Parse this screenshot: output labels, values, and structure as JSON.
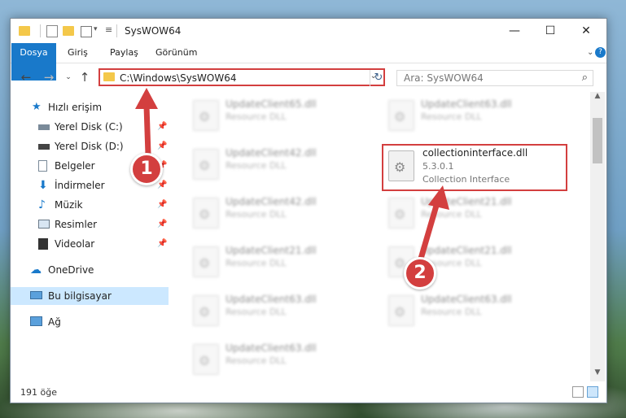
{
  "window": {
    "title": "SysWOW64"
  },
  "ribbon": {
    "tabs": [
      "Dosya",
      "Giriş",
      "Paylaş",
      "Görünüm"
    ]
  },
  "address": {
    "path": "C:\\Windows\\SysWOW64"
  },
  "search": {
    "placeholder": "Ara: SysWOW64"
  },
  "nav": {
    "quick_access": "Hızlı erişim",
    "items": [
      {
        "label": "Yerel Disk (C:)",
        "icon": "drive-icon"
      },
      {
        "label": "Yerel Disk (D:)",
        "icon": "drive-icon"
      },
      {
        "label": "Belgeler",
        "icon": "documents-icon"
      },
      {
        "label": "İndirmeler",
        "icon": "download-icon"
      },
      {
        "label": "Müzik",
        "icon": "music-icon"
      },
      {
        "label": "Resimler",
        "icon": "pictures-icon"
      },
      {
        "label": "Videolar",
        "icon": "video-icon"
      }
    ],
    "onedrive": "OneDrive",
    "this_pc": "Bu bilgisayar",
    "network": "Ağ"
  },
  "files": [
    {
      "name": "UpdateClient65.dll",
      "desc": "Resource DLL"
    },
    {
      "name": "UpdateClient63.dll",
      "desc": "Resource DLL"
    },
    {
      "name": "UpdateClient42.dll",
      "desc": "Resource DLL"
    },
    {
      "name": "UpdateClient42.dll",
      "desc": "Resource DLL"
    },
    {
      "name": "UpdateClient21.dll",
      "desc": "Resource DLL"
    },
    {
      "name": "UpdateClient21.dll",
      "desc": "Resource DLL"
    },
    {
      "name": "UpdateClient21.dll",
      "desc": "Resource DLL"
    },
    {
      "name": "UpdateClient63.dll",
      "desc": "Resource DLL"
    },
    {
      "name": "UpdateClient63.dll",
      "desc": "Resource DLL"
    },
    {
      "name": "UpdateClient63.dll",
      "desc": "Resource DLL"
    }
  ],
  "selected_file": {
    "name": "collectioninterface.dll",
    "version": "5.3.0.1",
    "description": "Collection Interface"
  },
  "status": {
    "count": "191 öğe"
  },
  "annotations": {
    "step1": "1",
    "step2": "2"
  },
  "colors": {
    "accent": "#1979ca",
    "highlight": "#d33f3f",
    "selected_nav": "#cce8ff"
  }
}
